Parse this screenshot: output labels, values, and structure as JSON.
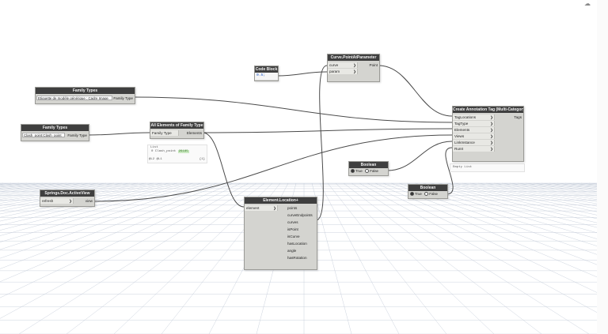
{
  "colors": {
    "wire": "#4a4a4a",
    "grid": "#bfc8d6",
    "node_title_bg": "#3f3f3f",
    "node_body_bg": "#d4d4d0",
    "code_value": "#1a55c8"
  },
  "corner_icon": "cloud-sync-icon",
  "nodes": {
    "family_types_1": {
      "title": "Family Types",
      "dropdown": "Etiquette de modèle générique : Cadre Image",
      "output": "Family Type"
    },
    "family_types_2": {
      "title": "Family Types",
      "dropdown": "Clash_point:Clash_point",
      "output": "Family Type"
    },
    "all_elements": {
      "title": "All Elements of Family Type",
      "input": "Family Type",
      "output": "Elements",
      "preview": {
        "header": "List",
        "index": "0",
        "item_label": "Clash_point",
        "item_chip": "26185",
        "footer_left": "@L2 @L1",
        "footer_right": "{1}"
      }
    },
    "code_block": {
      "title": "Code Block",
      "value": "0.5;"
    },
    "curve_point": {
      "title": "Curve.PointAtParameter",
      "inputs": [
        "curve",
        "param"
      ],
      "output": "Point"
    },
    "create_tag": {
      "title": "Create Annotation Tag (Multi-Category)",
      "inputs": [
        "TagLocations",
        "TagType",
        "Elements",
        "Views",
        "LinkInstance",
        "RunIt"
      ],
      "output": "Tags",
      "preview": "Empty List"
    },
    "boolean_1": {
      "title": "Boolean",
      "true_label": "True",
      "false_label": "False",
      "selected": "True"
    },
    "boolean_2": {
      "title": "Boolean",
      "true_label": "True",
      "false_label": "False",
      "selected": "True"
    },
    "active_view": {
      "title": "Springs.Doc.ActiveView",
      "input": "refresh",
      "output": "view"
    },
    "element_location": {
      "title": "Element.Location+",
      "input": "element",
      "outputs": [
        "points",
        "curveEndpoints",
        "curves",
        "isPoint",
        "isCurve",
        "hasLocation",
        "angle",
        "hasRotation"
      ]
    }
  }
}
